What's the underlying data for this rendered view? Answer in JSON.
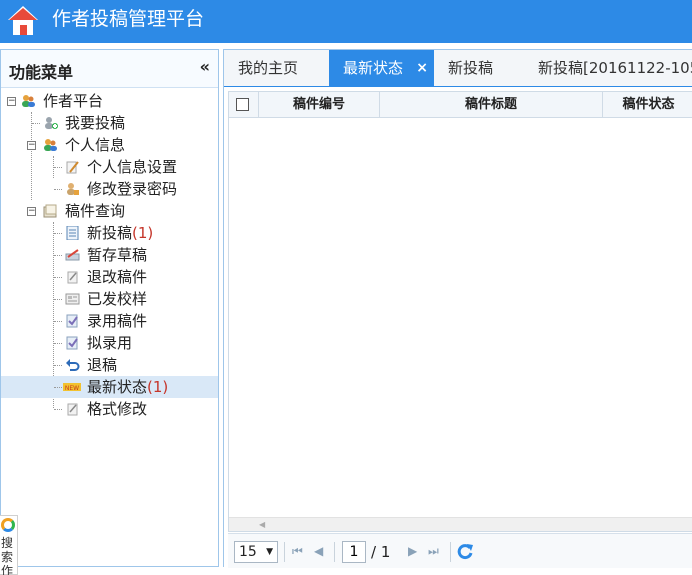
{
  "app": {
    "title": "作者投稿管理平台"
  },
  "sidebar": {
    "title": "功能菜单",
    "collapse": "«",
    "tree": [
      {
        "label": "作者平台",
        "icon": "users-icon",
        "toggle": "⊟"
      },
      {
        "label": "我要投稿",
        "icon": "add-person-icon"
      },
      {
        "label": "个人信息",
        "icon": "users-icon",
        "toggle": "⊟"
      },
      {
        "label": "个人信息设置",
        "icon": "edit-icon"
      },
      {
        "label": "修改登录密码",
        "icon": "lock-user-icon"
      },
      {
        "label": "稿件查询",
        "icon": "document-icon",
        "toggle": "⊟"
      },
      {
        "label": "新投稿",
        "count": "(1)",
        "icon": "new-document-icon"
      },
      {
        "label": "暂存草稿",
        "icon": "draft-icon"
      },
      {
        "label": "退改稿件",
        "icon": "revise-icon"
      },
      {
        "label": "已发校样",
        "icon": "proof-icon"
      },
      {
        "label": "录用稿件",
        "icon": "accept-icon"
      },
      {
        "label": "拟录用",
        "icon": "pending-accept-icon"
      },
      {
        "label": "退稿",
        "icon": "return-icon"
      },
      {
        "label": "最新状态",
        "count": "(1)",
        "icon": "new-badge-icon"
      },
      {
        "label": "格式修改",
        "icon": "format-icon"
      }
    ]
  },
  "tabs": [
    {
      "label": "我的主页"
    },
    {
      "label": "最新状态",
      "close": "×"
    },
    {
      "label": "新投稿"
    },
    {
      "label": "新投稿[20161122-105"
    }
  ],
  "grid": {
    "columns": [
      "稿件编号",
      "稿件标题",
      "稿件状态"
    ]
  },
  "pager": {
    "page_size": "15",
    "current_page": "1",
    "total": "/ 1"
  },
  "float_search": {
    "label": "搜索作"
  },
  "colors": {
    "brand": "#2d8ae6",
    "selected_row": "#d9e8f7",
    "count": "#c5352a"
  }
}
